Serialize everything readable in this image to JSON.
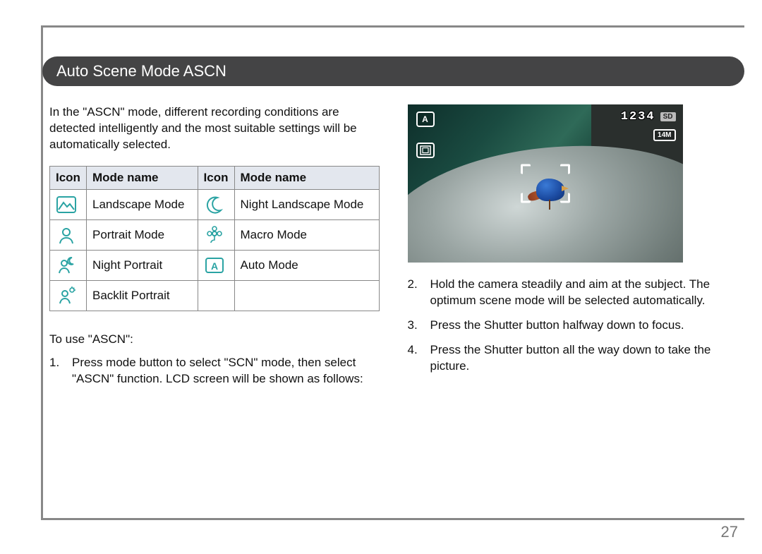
{
  "heading": "Auto Scene Mode ASCN",
  "intro": "In the \"ASCN\" mode, different recording conditions are detected intelligently and the most suitable settings will be automatically selected.",
  "table": {
    "headers": {
      "icon": "Icon",
      "mode_name": "Mode name"
    },
    "rows": [
      {
        "left": "Landscape Mode",
        "right": "Night Landscape Mode"
      },
      {
        "left": "Portrait Mode",
        "right": "Macro Mode"
      },
      {
        "left": "Night Portrait",
        "right": "Auto Mode"
      },
      {
        "left": "Backlit Portrait",
        "right": ""
      }
    ]
  },
  "subhead": "To use \"ASCN\":",
  "steps": {
    "1": "Press mode button to select \"SCN\" mode, then select \"ASCN\" function. LCD screen will be shown as follows:",
    "2": "Hold the camera steadily and aim at the subject. The optimum scene mode will be selected automatically.",
    "3": "Press the Shutter button halfway down to focus.",
    "4": "Press the Shutter button all the way down to take the picture."
  },
  "lcd": {
    "osd_a": "A",
    "counter": "1234",
    "sd_label": "SD",
    "res_label": "14M"
  },
  "page_number": "27"
}
